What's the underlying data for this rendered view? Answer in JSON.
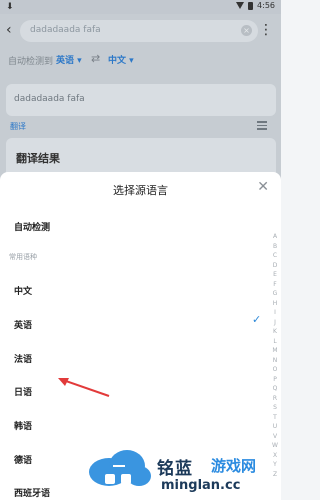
{
  "status_bar": {
    "time": "4:56",
    "download_icon": "download-icon",
    "wifi_icon": "wifi-icon",
    "battery_icon": "battery-icon"
  },
  "search": {
    "value": "dadadaada fafa",
    "clear_icon": "clear-icon"
  },
  "header": {
    "back_icon": "back-icon",
    "more_icon": "more-icon"
  },
  "language_bar": {
    "auto_detect_label": "自动检测到",
    "source_lang": "英语",
    "target_lang": "中文",
    "swap_icon": "swap-icon"
  },
  "input_card": {
    "text": "dadadaada fafa"
  },
  "translate": {
    "link_label": "翻译",
    "result_title": "翻译结果"
  },
  "sheet": {
    "title": "选择源语言",
    "close_icon": "close-icon",
    "auto_detect": "自动检测",
    "section_common": "常用语种",
    "languages": [
      "中文",
      "英语",
      "法语",
      "日语",
      "韩语",
      "德语",
      "西班牙语"
    ],
    "selected_index": 1
  },
  "alphabet": [
    "A",
    "B",
    "C",
    "D",
    "E",
    "F",
    "G",
    "H",
    "I",
    "J",
    "K",
    "L",
    "M",
    "N",
    "O",
    "P",
    "Q",
    "R",
    "S",
    "T",
    "U",
    "V",
    "W",
    "X",
    "Y",
    "Z"
  ],
  "watermark": {
    "cn": "铭蓝",
    "cn2": "游戏网",
    "url": "minglan.cc"
  },
  "colors": {
    "accent": "#2c78c8",
    "check": "#2c88d8",
    "arrow": "#e23a3a"
  }
}
